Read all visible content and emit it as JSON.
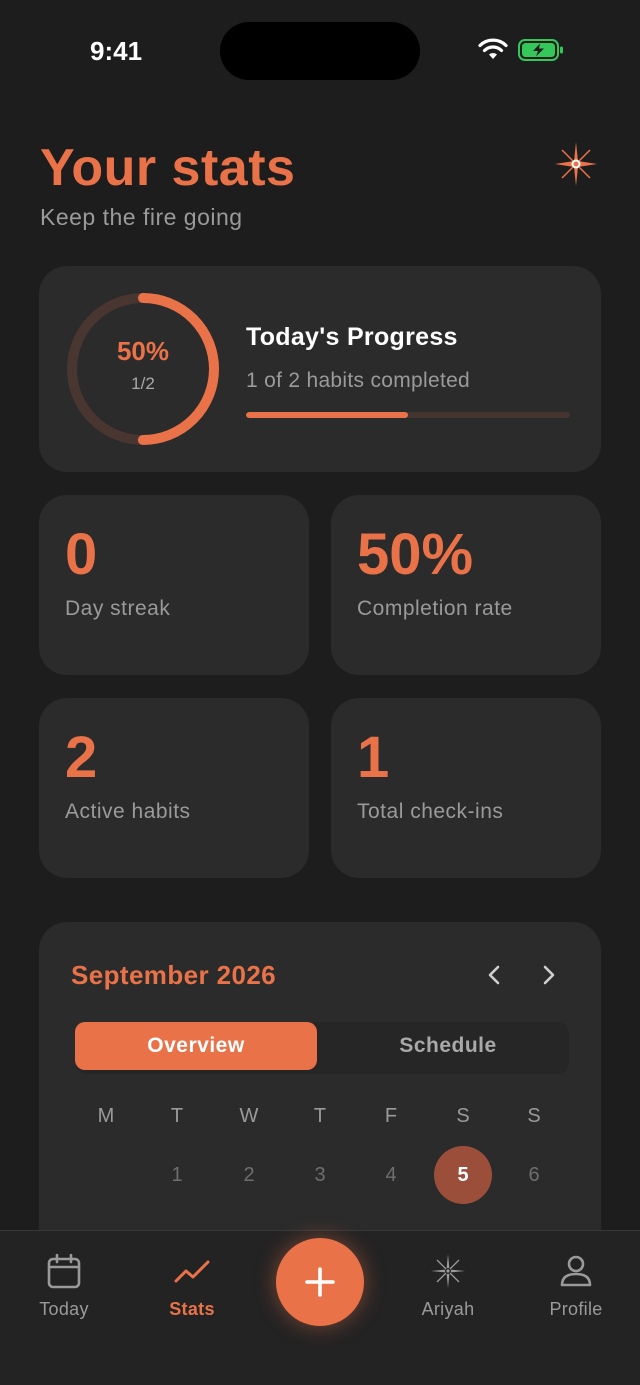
{
  "status_bar": {
    "time": "9:41"
  },
  "header": {
    "title": "Your stats",
    "subtitle": "Keep the fire going"
  },
  "progress": {
    "percent_label": "50%",
    "fraction_label": "1/2",
    "title": "Today's Progress",
    "subtitle": "1 of 2 habits completed",
    "fraction": 0.5
  },
  "stats": [
    {
      "value": "0",
      "label": "Day streak"
    },
    {
      "value": "50%",
      "label": "Completion rate"
    },
    {
      "value": "2",
      "label": "Active habits"
    },
    {
      "value": "1",
      "label": "Total check-ins"
    }
  ],
  "calendar": {
    "month": "September 2026",
    "segments": [
      "Overview",
      "Schedule"
    ],
    "active_segment": "Overview",
    "weekdays": [
      "M",
      "T",
      "W",
      "T",
      "F",
      "S",
      "S"
    ],
    "days": [
      "1",
      "2",
      "3",
      "4",
      "5",
      "6"
    ],
    "selected_day": "5"
  },
  "tabbar": {
    "items": [
      {
        "label": "Today",
        "icon": "calendar-icon"
      },
      {
        "label": "Stats",
        "icon": "trend-icon",
        "active": true
      },
      {
        "label": "Ariyah",
        "icon": "sparkle-icon"
      },
      {
        "label": "Profile",
        "icon": "person-icon"
      }
    ],
    "fab_icon": "plus-icon"
  },
  "colors": {
    "accent": "#ea7249",
    "background": "#1d1d1d",
    "card": "#2b2b2b",
    "battery": "#34c759"
  }
}
